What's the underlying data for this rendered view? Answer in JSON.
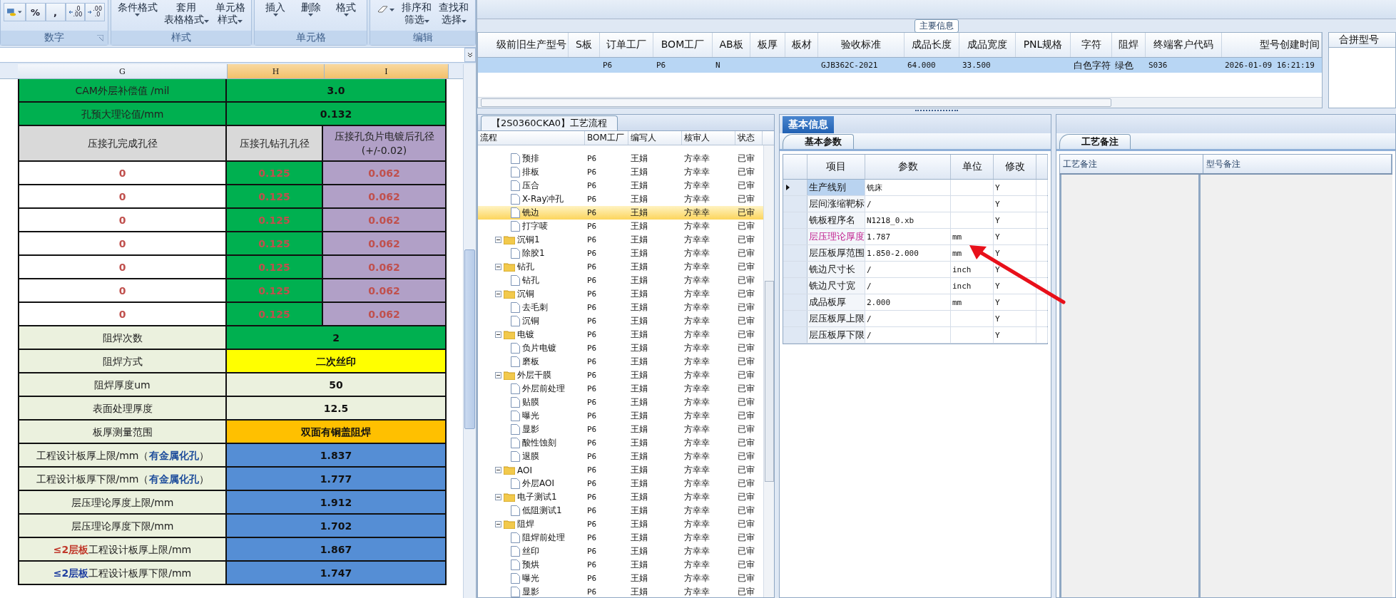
{
  "ribbon": {
    "groups": [
      {
        "label": "数字",
        "kind": "number",
        "percent": "%",
        "comma": ",",
        "increase_decimal": {
          "top": ".0",
          "bottom": ".00"
        },
        "decrease_decimal": {
          "top": ".00",
          "bottom": ".0"
        }
      },
      {
        "label": "样式",
        "kind": "buttons",
        "buttons": [
          {
            "lines": [
              "条件格式"
            ]
          },
          {
            "lines": [
              "套用",
              "表格格式"
            ]
          },
          {
            "lines": [
              "单元格",
              "样式"
            ]
          }
        ]
      },
      {
        "label": "单元格",
        "kind": "buttons",
        "buttons": [
          {
            "lines": [
              "插入"
            ]
          },
          {
            "lines": [
              "删除"
            ]
          },
          {
            "lines": [
              "格式"
            ]
          }
        ]
      },
      {
        "label": "编辑",
        "kind": "editing",
        "buttons": [
          {
            "lines": [
              "排序和",
              "筛选"
            ]
          },
          {
            "lines": [
              "查找和",
              "选择"
            ]
          }
        ]
      }
    ]
  },
  "sheet": {
    "columns": [
      {
        "letter": "G",
        "selected": false
      },
      {
        "letter": "H",
        "selected": true
      },
      {
        "letter": "I",
        "selected": true
      }
    ],
    "rows": [
      {
        "kind": "merged",
        "cells": [
          {
            "text": "CAM外层补偿值 /mil",
            "color": "#00b050"
          },
          {
            "text": "3.0",
            "color": "#00b050",
            "kind": "value"
          }
        ]
      },
      {
        "kind": "merged",
        "cells": [
          {
            "text": "孔预大理论值/mm",
            "color": "#00b050"
          },
          {
            "text": "0.132",
            "color": "#00b050",
            "kind": "value"
          }
        ]
      },
      {
        "kind": "split",
        "cells": [
          {
            "text": "压接孔完成孔径",
            "color": "#d9d9d9"
          },
          {
            "text": "压接孔钻孔孔径",
            "color": "#d9d9d9"
          },
          {
            "text": "压接孔负片电镀后孔径(+/-0.02)",
            "color": "#b1a0c7"
          }
        ]
      },
      {
        "kind": "split",
        "cells": [
          {
            "text": "0",
            "color": "#ffffff",
            "kind": "alert"
          },
          {
            "text": "0.125",
            "color": "#00b050",
            "kind": "alert"
          },
          {
            "text": "0.062",
            "color": "#b1a0c7",
            "kind": "alert"
          }
        ]
      },
      {
        "kind": "split",
        "cells": [
          {
            "text": "0",
            "color": "#ffffff",
            "kind": "alert"
          },
          {
            "text": "0.125",
            "color": "#00b050",
            "kind": "alert"
          },
          {
            "text": "0.062",
            "color": "#b1a0c7",
            "kind": "alert"
          }
        ]
      },
      {
        "kind": "split",
        "cells": [
          {
            "text": "0",
            "color": "#ffffff",
            "kind": "alert"
          },
          {
            "text": "0.125",
            "color": "#00b050",
            "kind": "alert"
          },
          {
            "text": "0.062",
            "color": "#b1a0c7",
            "kind": "alert"
          }
        ]
      },
      {
        "kind": "split",
        "cells": [
          {
            "text": "0",
            "color": "#ffffff",
            "kind": "alert"
          },
          {
            "text": "0.125",
            "color": "#00b050",
            "kind": "alert"
          },
          {
            "text": "0.062",
            "color": "#b1a0c7",
            "kind": "alert"
          }
        ]
      },
      {
        "kind": "split",
        "cells": [
          {
            "text": "0",
            "color": "#ffffff",
            "kind": "alert"
          },
          {
            "text": "0.125",
            "color": "#00b050",
            "kind": "alert"
          },
          {
            "text": "0.062",
            "color": "#b1a0c7",
            "kind": "alert"
          }
        ]
      },
      {
        "kind": "split",
        "cells": [
          {
            "text": "0",
            "color": "#ffffff",
            "kind": "alert"
          },
          {
            "text": "0.125",
            "color": "#00b050",
            "kind": "alert"
          },
          {
            "text": "0.062",
            "color": "#b1a0c7",
            "kind": "alert"
          }
        ]
      },
      {
        "kind": "split",
        "cells": [
          {
            "text": "0",
            "color": "#ffffff",
            "kind": "alert"
          },
          {
            "text": "0.125",
            "color": "#00b050",
            "kind": "alert"
          },
          {
            "text": "0.062",
            "color": "#b1a0c7",
            "kind": "alert"
          }
        ]
      },
      {
        "kind": "merged",
        "cells": [
          {
            "text": "阻焊次数",
            "color": "#ebf1de"
          },
          {
            "text": "2",
            "color": "#00b050",
            "kind": "value"
          }
        ]
      },
      {
        "kind": "merged",
        "cells": [
          {
            "text": "阻焊方式",
            "color": "#ebf1de"
          },
          {
            "text": "二次丝印",
            "color": "#ffff00",
            "kind": "value"
          }
        ]
      },
      {
        "kind": "merged",
        "cells": [
          {
            "text": "阻焊厚度um",
            "color": "#ebf1de"
          },
          {
            "text": "50",
            "color": "#ebf1de",
            "kind": "value"
          }
        ]
      },
      {
        "kind": "merged",
        "cells": [
          {
            "text": "表面处理厚度",
            "color": "#ebf1de"
          },
          {
            "text": "12.5",
            "color": "#ebf1de",
            "kind": "value"
          }
        ]
      },
      {
        "kind": "merged",
        "cells": [
          {
            "text": "板厚测量范围",
            "color": "#ebf1de"
          },
          {
            "text": "双面有铜盖阻焊",
            "color": "#ffc000",
            "kind": "value"
          }
        ]
      },
      {
        "kind": "merged",
        "cells": [
          {
            "text": "工程设计板厚上限/mm（**有金属化孔**）",
            "color": "#ebf1de",
            "emphasis": {
              "color": "#1f4e9c"
            }
          },
          {
            "text": "1.837",
            "color": "#558ed5",
            "kind": "value"
          }
        ]
      },
      {
        "kind": "merged",
        "cells": [
          {
            "text": "工程设计板厚下限/mm（**有金属化孔**）",
            "color": "#ebf1de",
            "emphasis": {
              "color": "#1f4e9c"
            }
          },
          {
            "text": "1.777",
            "color": "#558ed5",
            "kind": "value"
          }
        ]
      },
      {
        "kind": "merged",
        "cells": [
          {
            "text": "层压理论厚度上限/mm",
            "color": "#ebf1de"
          },
          {
            "text": "1.912",
            "color": "#558ed5",
            "kind": "value"
          }
        ]
      },
      {
        "kind": "merged",
        "cells": [
          {
            "text": "层压理论厚度下限/mm",
            "color": "#ebf1de"
          },
          {
            "text": "1.702",
            "color": "#558ed5",
            "kind": "value"
          }
        ]
      },
      {
        "kind": "merged",
        "cells": [
          {
            "text": "**≤2层板**工程设计板厚上限/mm",
            "color": "#ebf1de",
            "emphasis": {
              "color": "#c0392b"
            }
          },
          {
            "text": "1.867",
            "color": "#558ed5",
            "kind": "value"
          }
        ]
      },
      {
        "kind": "merged",
        "cells": [
          {
            "text": "**≤2层板**工程设计板厚下限/mm",
            "color": "#ebf1de",
            "emphasis": {
              "color": "#1f3fa0"
            }
          },
          {
            "text": "1.747",
            "color": "#558ed5",
            "kind": "value"
          }
        ]
      }
    ]
  },
  "main_info": {
    "title": "主要信息",
    "columns": [
      "级前旧生产型号",
      "S板",
      "订单工厂",
      "BOM工厂",
      "AB板",
      "板厚",
      "板材",
      "验收标准",
      "成品长度",
      "成品宽度",
      "PNL规格",
      "字符",
      "阻焊",
      "终端客户代码",
      "型号创建时间"
    ],
    "rows": [
      {
        "selected": true,
        "cells": [
          null,
          null,
          "P6",
          "P6",
          "N",
          null,
          null,
          "GJB362C-2021",
          "64.000",
          "33.500",
          null,
          "白色字符",
          "绿色",
          "S036",
          "2026-01-09 16:21:19"
        ]
      }
    ],
    "side_column": "合拼型号"
  },
  "process": {
    "tab": "【2S0360CKA0】工艺流程",
    "columns": [
      "流程",
      "BOM工厂",
      "编写人",
      "核审人",
      "状态"
    ],
    "continued": [
      {
        "name": "预排",
        "bom": "P6",
        "writer": "王娟",
        "reviewer": "方幸幸",
        "status": "已审",
        "selected": false
      },
      {
        "name": "排板",
        "bom": "P6",
        "writer": "王娟",
        "reviewer": "方幸幸",
        "status": "已审",
        "selected": false
      },
      {
        "name": "压合",
        "bom": "P6",
        "writer": "王娟",
        "reviewer": "方幸幸",
        "status": "已审",
        "selected": false
      },
      {
        "name": "X-Ray冲孔",
        "bom": "P6",
        "writer": "王娟",
        "reviewer": "方幸幸",
        "status": "已审",
        "selected": false
      },
      {
        "name": "铣边",
        "bom": "P6",
        "writer": "王娟",
        "reviewer": "方幸幸",
        "status": "已审",
        "selected": true
      },
      {
        "name": "打字唛",
        "bom": "P6",
        "writer": "王娟",
        "reviewer": "方幸幸",
        "status": "已审",
        "selected": false
      }
    ],
    "groups": [
      {
        "name": "沉铜1",
        "bom": "P6",
        "writer": "王娟",
        "reviewer": "方幸幸",
        "status": "已审",
        "expanded": true,
        "selected": false,
        "children": [
          {
            "name": "除胶1",
            "bom": "P6",
            "writer": "王娟",
            "reviewer": "方幸幸",
            "status": "已审",
            "selected": false
          }
        ]
      },
      {
        "name": "钻孔",
        "bom": "P6",
        "writer": "王娟",
        "reviewer": "方幸幸",
        "status": "已审",
        "expanded": true,
        "selected": false,
        "children": [
          {
            "name": "钻孔",
            "bom": "P6",
            "writer": "王娟",
            "reviewer": "方幸幸",
            "status": "已审",
            "selected": false
          }
        ]
      },
      {
        "name": "沉铜",
        "bom": "P6",
        "writer": "王娟",
        "reviewer": "方幸幸",
        "status": "已审",
        "expanded": true,
        "selected": false,
        "children": [
          {
            "name": "去毛刺",
            "bom": "P6",
            "writer": "王娟",
            "reviewer": "方幸幸",
            "status": "已审",
            "selected": false
          },
          {
            "name": "沉铜",
            "bom": "P6",
            "writer": "王娟",
            "reviewer": "方幸幸",
            "status": "已审",
            "selected": false
          }
        ]
      },
      {
        "name": "电镀",
        "bom": "P6",
        "writer": "王娟",
        "reviewer": "方幸幸",
        "status": "已审",
        "expanded": true,
        "selected": false,
        "children": [
          {
            "name": "负片电镀",
            "bom": "P6",
            "writer": "王娟",
            "reviewer": "方幸幸",
            "status": "已审",
            "selected": false
          },
          {
            "name": "磨板",
            "bom": "P6",
            "writer": "王娟",
            "reviewer": "方幸幸",
            "status": "已审",
            "selected": false
          }
        ]
      },
      {
        "name": "外层干膜",
        "bom": "P6",
        "writer": "王娟",
        "reviewer": "方幸幸",
        "status": "已审",
        "expanded": true,
        "selected": false,
        "children": [
          {
            "name": "外层前处理",
            "bom": "P6",
            "writer": "王娟",
            "reviewer": "方幸幸",
            "status": "已审",
            "selected": false
          },
          {
            "name": "贴膜",
            "bom": "P6",
            "writer": "王娟",
            "reviewer": "方幸幸",
            "status": "已审",
            "selected": false
          },
          {
            "name": "曝光",
            "bom": "P6",
            "writer": "王娟",
            "reviewer": "方幸幸",
            "status": "已审",
            "selected": false
          },
          {
            "name": "显影",
            "bom": "P6",
            "writer": "王娟",
            "reviewer": "方幸幸",
            "status": "已审",
            "selected": false
          },
          {
            "name": "酸性蚀刻",
            "bom": "P6",
            "writer": "王娟",
            "reviewer": "方幸幸",
            "status": "已审",
            "selected": false
          },
          {
            "name": "退膜",
            "bom": "P6",
            "writer": "王娟",
            "reviewer": "方幸幸",
            "status": "已审",
            "selected": false
          }
        ]
      },
      {
        "name": "AOI",
        "bom": "P6",
        "writer": "王娟",
        "reviewer": "方幸幸",
        "status": "已审",
        "expanded": true,
        "selected": false,
        "children": [
          {
            "name": "外层AOI",
            "bom": "P6",
            "writer": "王娟",
            "reviewer": "方幸幸",
            "status": "已审",
            "selected": false
          }
        ]
      },
      {
        "name": "电子测试1",
        "bom": "P6",
        "writer": "王娟",
        "reviewer": "方幸幸",
        "status": "已审",
        "expanded": true,
        "selected": false,
        "children": [
          {
            "name": "低阻测试1",
            "bom": "P6",
            "writer": "王娟",
            "reviewer": "方幸幸",
            "status": "已审",
            "selected": false
          }
        ]
      },
      {
        "name": "阻焊",
        "bom": "P6",
        "writer": "王娟",
        "reviewer": "方幸幸",
        "status": "已审",
        "expanded": true,
        "selected": false,
        "children": [
          {
            "name": "阻焊前处理",
            "bom": "P6",
            "writer": "王娟",
            "reviewer": "方幸幸",
            "status": "已审",
            "selected": false
          },
          {
            "name": "丝印",
            "bom": "P6",
            "writer": "王娟",
            "reviewer": "方幸幸",
            "status": "已审",
            "selected": false
          },
          {
            "name": "预烘",
            "bom": "P6",
            "writer": "王娟",
            "reviewer": "方幸幸",
            "status": "已审",
            "selected": false
          },
          {
            "name": "曝光",
            "bom": "P6",
            "writer": "王娟",
            "reviewer": "方幸幸",
            "status": "已审",
            "selected": false
          },
          {
            "name": "显影",
            "bom": "P6",
            "writer": "王娟",
            "reviewer": "方幸幸",
            "status": "已审",
            "selected": false
          }
        ]
      }
    ]
  },
  "basic": {
    "tabs": [
      {
        "label": "基本信息",
        "selected": true
      }
    ],
    "subtab": "基本参数",
    "columns": [
      "项目",
      "参数",
      "单位",
      "修改"
    ],
    "rows": [
      {
        "item": "生产线别",
        "value": "铣床",
        "unit": null,
        "editable": "Y",
        "selected": true,
        "flagged": false
      },
      {
        "item": "层间涨缩靶标",
        "value": "/",
        "unit": null,
        "editable": "Y",
        "selected": false,
        "flagged": false
      },
      {
        "item": "铣板程序名",
        "value": "N1218_0.xb",
        "unit": null,
        "editable": "Y",
        "selected": false,
        "flagged": false
      },
      {
        "item": "层压理论厚度",
        "value": "1.787",
        "unit": "mm",
        "editable": "Y",
        "selected": false,
        "flagged": true
      },
      {
        "item": "层压板厚范围",
        "value": "1.850-2.000",
        "unit": "mm",
        "editable": "Y",
        "selected": false,
        "flagged": false
      },
      {
        "item": "铣边尺寸长",
        "value": "/",
        "unit": "inch",
        "editable": "Y",
        "selected": false,
        "flagged": false
      },
      {
        "item": "铣边尺寸宽",
        "value": "/",
        "unit": "inch",
        "editable": "Y",
        "selected": false,
        "flagged": false
      },
      {
        "item": "成品板厚",
        "value": "2.000",
        "unit": "mm",
        "editable": "Y",
        "selected": false,
        "flagged": false
      },
      {
        "item": "层压板厚上限",
        "value": "/",
        "unit": null,
        "editable": "Y",
        "selected": false,
        "flagged": false
      },
      {
        "item": "层压板厚下限",
        "value": "/",
        "unit": null,
        "editable": "Y",
        "selected": false,
        "flagged": false
      }
    ]
  },
  "notes": {
    "tab": "工艺备注",
    "columns": [
      "工艺备注",
      "型号备注"
    ]
  }
}
